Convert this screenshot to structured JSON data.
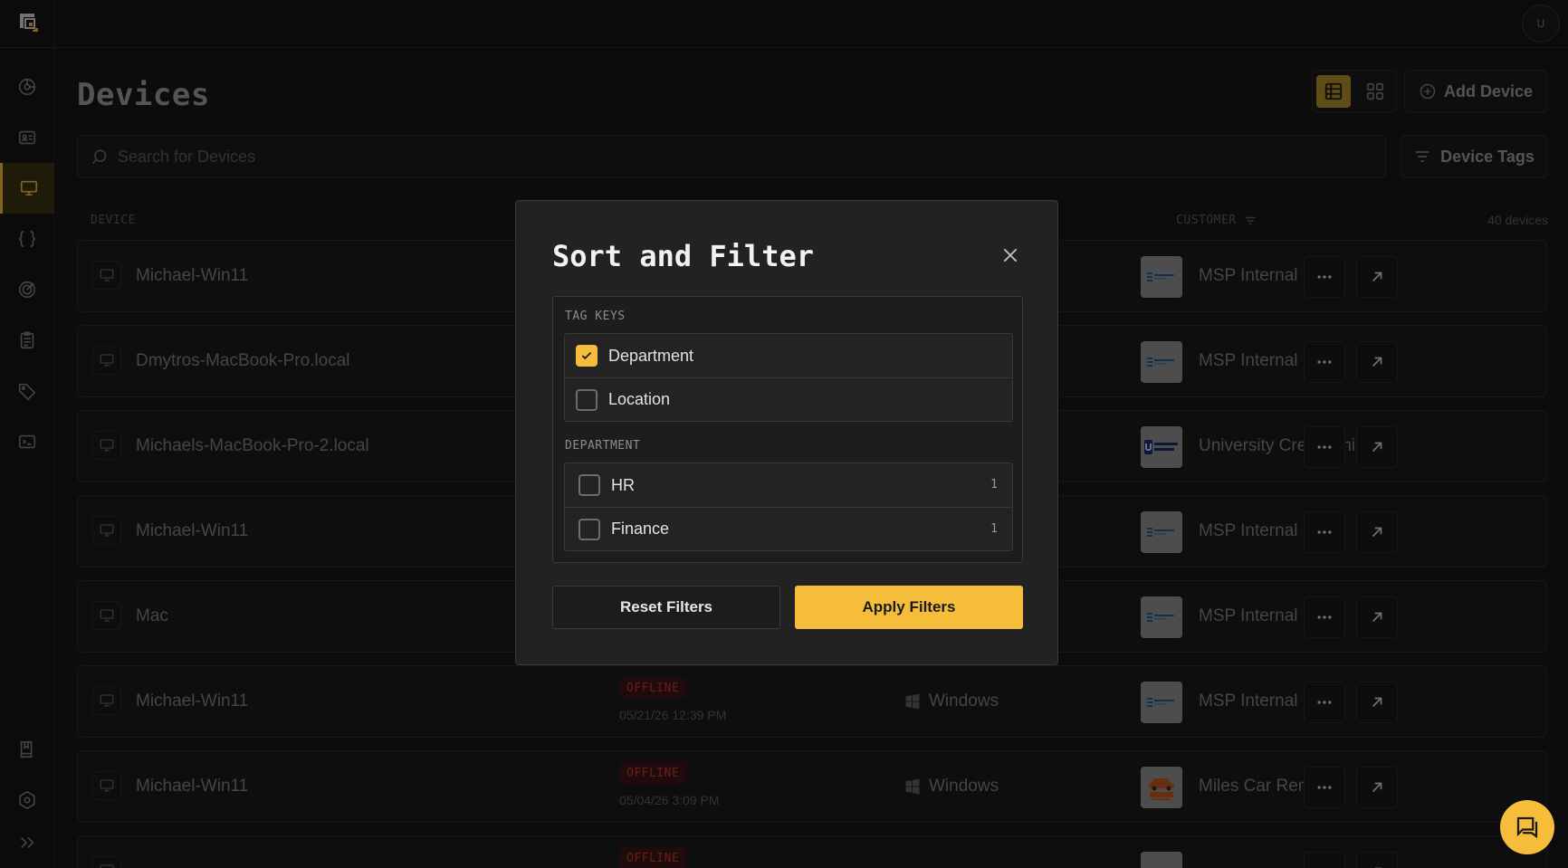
{
  "colors": {
    "accent": "#f6bd3b",
    "offline": "#c0392b",
    "bg": "#161616"
  },
  "header": {
    "avatar_initial": "U",
    "logo_icon": "app-logo-icon"
  },
  "sidebar": {
    "items": [
      {
        "icon": "dashboard-icon"
      },
      {
        "icon": "contact-card-icon"
      },
      {
        "icon": "monitor-icon",
        "active": true
      },
      {
        "icon": "braces-icon"
      },
      {
        "icon": "target-icon"
      },
      {
        "icon": "clipboard-icon"
      },
      {
        "icon": "tag-icon"
      },
      {
        "icon": "terminal-icon"
      },
      {
        "icon": "book-icon"
      },
      {
        "icon": "settings-icon"
      },
      {
        "icon": "expand-icon"
      }
    ]
  },
  "page": {
    "title": "Devices",
    "add_device_label": "Add Device",
    "device_tags_label": "Device Tags",
    "search_placeholder": "Search for Devices"
  },
  "table": {
    "columns": {
      "device": "DEVICE",
      "customer": "CUSTOMER"
    },
    "count_label": "40 devices",
    "rows": [
      {
        "name": "Michael-Win11",
        "status": "",
        "last_seen": "",
        "os": "",
        "customer": "MSP Internal",
        "logo": "msp"
      },
      {
        "name": "Dmytros-MacBook-Pro.local",
        "status": "",
        "last_seen": "",
        "os": "",
        "customer": "MSP Internal",
        "logo": "msp"
      },
      {
        "name": "Michaels-MacBook-Pro-2.local",
        "status": "",
        "last_seen": "",
        "os": "",
        "customer": "University Credit Union",
        "logo": "ucu"
      },
      {
        "name": "Michael-Win11",
        "status": "",
        "last_seen": "",
        "os": "",
        "customer": "MSP Internal",
        "logo": "msp"
      },
      {
        "name": "Mac",
        "status": "",
        "last_seen": "",
        "os": "",
        "customer": "MSP Internal",
        "logo": "msp"
      },
      {
        "name": "Michael-Win11",
        "status": "OFFLINE",
        "last_seen": "05/21/26 12:39 PM",
        "os": "Windows",
        "customer": "MSP Internal",
        "logo": "msp"
      },
      {
        "name": "Michael-Win11",
        "status": "OFFLINE",
        "last_seen": "05/04/26 3:09 PM",
        "os": "Windows",
        "customer": "Miles Car Rental",
        "logo": "miles"
      },
      {
        "name": "",
        "status": "OFFLINE",
        "last_seen": "",
        "os": "",
        "customer": "",
        "logo": "msp"
      }
    ]
  },
  "modal": {
    "title": "Sort and Filter",
    "tag_keys_label": "TAG KEYS",
    "tag_keys": [
      {
        "label": "Department",
        "checked": true
      },
      {
        "label": "Location",
        "checked": false
      }
    ],
    "department_label": "DEPARTMENT",
    "department_values": [
      {
        "label": "HR",
        "count": "1",
        "checked": false
      },
      {
        "label": "Finance",
        "count": "1",
        "checked": false
      }
    ],
    "reset_label": "Reset Filters",
    "apply_label": "Apply Filters"
  }
}
